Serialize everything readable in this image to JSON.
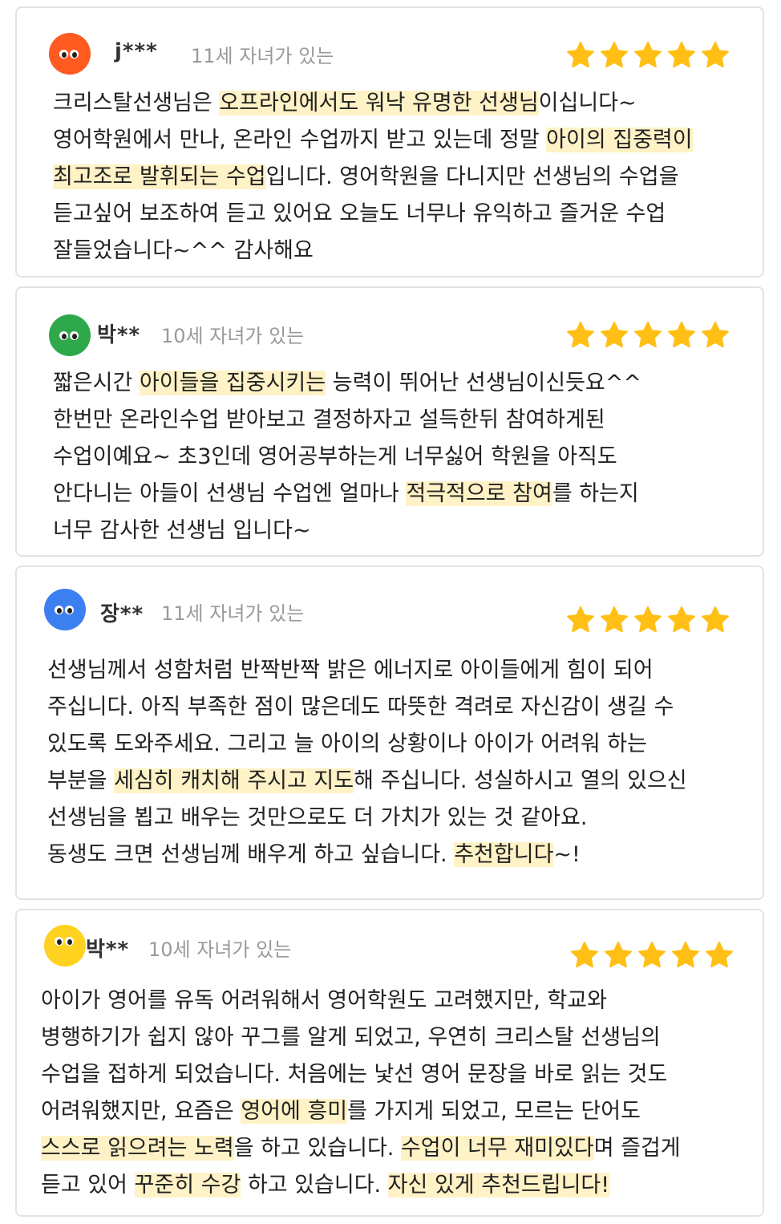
{
  "colors": {
    "star": "#ffbf14",
    "highlight": "#fff2c6",
    "avatar_orange": "#ff5a1f",
    "avatar_green": "#2ea84a",
    "avatar_blue": "#3c7ff1",
    "avatar_yellow": "#ffd21f"
  },
  "icons": {
    "rating": "star-icon",
    "avatar": "face-avatar-icon"
  },
  "reviews": [
    {
      "name": "j***",
      "meta": "11세 자녀가 있는",
      "rating": 5,
      "lines": [
        [
          "크리스탈선생님은 ",
          "오프라인에서도 워낙 유명한 선생님",
          "이십니다~"
        ],
        [
          "영어학원에서 만나, 온라인 수업까지 받고 있는데 정말 ",
          "아이의 집중력이",
          ""
        ],
        [
          "",
          "최고조로 발휘되는 수업",
          "입니다. 영어학원을 다니지만 선생님의 수업을"
        ],
        [
          "듣고싶어 보조하여 듣고 있어요 오늘도 너무나 유익하고 즐거운 수업",
          "",
          ""
        ],
        [
          "잘들었습니다~^^ 감사해요",
          "",
          ""
        ]
      ]
    },
    {
      "name": "박**",
      "meta": "10세 자녀가 있는",
      "rating": 5,
      "lines": [
        [
          "짧은시간 ",
          "아이들을 집중시키는",
          " 능력이 뛰어난 선생님이신듯요^^"
        ],
        [
          "한번만 온라인수업 받아보고 결정하자고 설득한뒤 참여하게된",
          "",
          ""
        ],
        [
          "수업이예요~ 초3인데 영어공부하는게 너무싫어 학원을 아직도",
          "",
          ""
        ],
        [
          "안다니는 아들이 선생님 수업엔 얼마나 ",
          "적극적으로 참여",
          "를 하는지"
        ],
        [
          "너무 감사한 선생님 입니다~",
          "",
          ""
        ]
      ]
    },
    {
      "name": "장**",
      "meta": "11세 자녀가 있는",
      "rating": 5,
      "lines": [
        [
          "선생님께서 성함처럼 반짝반짝 밝은 에너지로 아이들에게 힘이 되어",
          "",
          ""
        ],
        [
          "주십니다. 아직 부족한 점이 많은데도 따뜻한 격려로 자신감이 생길 수",
          "",
          ""
        ],
        [
          "있도록 도와주세요. 그리고 늘 아이의 상황이나 아이가 어려워 하는",
          "",
          ""
        ],
        [
          "부분을 ",
          "세심히 캐치해 주시고 지도",
          "해 주십니다. 성실하시고 열의 있으신"
        ],
        [
          "선생님을 뵙고 배우는 것만으로도 더 가치가 있는 것 같아요.",
          "",
          ""
        ],
        [
          "동생도 크면 선생님께 배우게 하고 싶습니다. ",
          "추천합니다",
          "~!"
        ]
      ]
    },
    {
      "name": "박**",
      "meta": "10세 자녀가 있는",
      "rating": 5,
      "lines": [
        [
          "아이가 영어를 유독 어려워해서 영어학원도 고려했지만, 학교와",
          "",
          ""
        ],
        [
          "병행하기가 쉽지 않아 꾸그를 알게 되었고, 우연히 크리스탈 선생님의",
          "",
          ""
        ],
        [
          "수업을 접하게 되었습니다. 처음에는 낯선 영어 문장을 바로 읽는 것도",
          "",
          ""
        ],
        [
          "어려워했지만, 요즘은 ",
          "영어에 흥미",
          "를 가지게 되었고, 모르는 단어도"
        ],
        [
          "",
          "스스로 읽으려는 노력",
          "을 하고 있습니다. ",
          "수업이 너무 재미있다",
          "며 즐겁게"
        ],
        [
          "듣고 있어 ",
          "꾸준히 수강",
          " 하고 있습니다. ",
          "자신 있게 추천드립니다!",
          ""
        ]
      ]
    }
  ]
}
